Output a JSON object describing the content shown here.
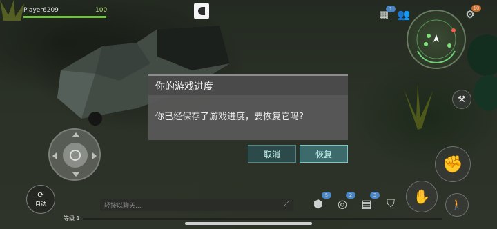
{
  "hud": {
    "player_name": "Player6209",
    "health": "100",
    "health_fraction": 1.0,
    "social_badge": "1",
    "settings_badge": "10"
  },
  "controls": {
    "auto_label": "自动",
    "chat_placeholder": "轻按以聊天...",
    "level_label": "等级 1"
  },
  "quick_slots": [
    {
      "icon": "cube-icon",
      "count": "5"
    },
    {
      "icon": "coins-icon",
      "count": "2"
    },
    {
      "icon": "map-icon",
      "count": "3"
    },
    {
      "icon": "backpack-icon",
      "count": ""
    }
  ],
  "dialog": {
    "title": "你的游戏进度",
    "message": "你已经保存了游戏进度，要恢复它吗?",
    "cancel_label": "取消",
    "confirm_label": "恢复"
  },
  "colors": {
    "health": "#6fc23b",
    "dialog_button_border": "#78c6c6",
    "badge": "#4a86c5"
  }
}
